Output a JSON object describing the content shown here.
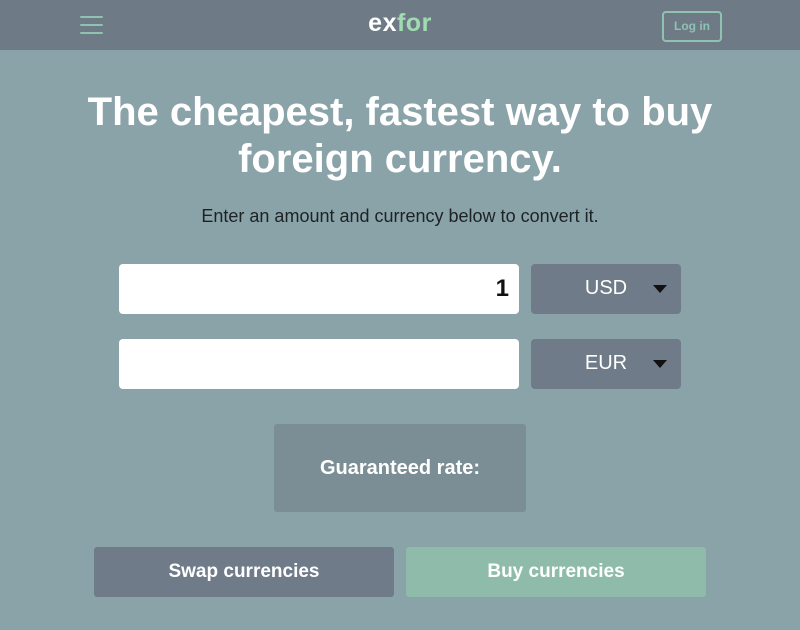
{
  "header": {
    "logo_part1": "ex",
    "logo_part2": "for",
    "menu_icon": "hamburger-menu-icon",
    "login_label": "Log in"
  },
  "hero": {
    "headline": "The cheapest, fastest way to buy foreign currency.",
    "subheadline": "Enter an amount and currency below to convert it."
  },
  "converter": {
    "from": {
      "amount": "1",
      "currency": "USD"
    },
    "to": {
      "amount": "",
      "currency": "EUR"
    },
    "caret_icon": "caret-down-icon"
  },
  "rate": {
    "label": "Guaranteed rate:"
  },
  "actions": {
    "swap_label": "Swap currencies",
    "buy_label": "Buy currencies"
  },
  "colors": {
    "background": "#8aa3a9",
    "topbar": "#6e7b86",
    "accent": "#8fc2b0",
    "select_bg": "#6f7b88",
    "buy_button": "#8fbcaa"
  }
}
